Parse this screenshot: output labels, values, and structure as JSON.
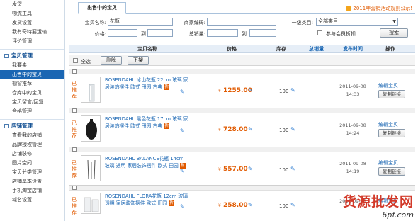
{
  "sidebar": {
    "top_items": [
      {
        "label": "发货"
      },
      {
        "label": "物流工具"
      },
      {
        "label": "发货设置"
      },
      {
        "label": "我有奇特要运输"
      },
      {
        "label": "评价管理"
      }
    ],
    "sections": [
      {
        "title": "宝贝管理",
        "items": [
          {
            "label": "我要卖"
          },
          {
            "label": "出售中的宝贝",
            "active": true
          },
          {
            "label": "橱窗推荐"
          },
          {
            "label": "仓库中的宝贝"
          },
          {
            "label": "宝贝留言/回复"
          },
          {
            "label": "合格管理"
          }
        ]
      },
      {
        "title": "店铺管理",
        "items": [
          {
            "label": "查看我的店铺"
          },
          {
            "label": "品牌授权管理"
          },
          {
            "label": "店铺装修"
          },
          {
            "label": "图片空间"
          },
          {
            "label": "宝贝分类管理"
          },
          {
            "label": "店铺基本设置"
          },
          {
            "label": "手机淘宝店铺"
          },
          {
            "label": "域名设置"
          }
        ]
      }
    ]
  },
  "tabs": {
    "active": "出售中的宝贝"
  },
  "promo": "2011年营销活动规则公示!",
  "search": {
    "name_label": "宝贝名称:",
    "name_value": "花瓶",
    "code_label": "商家编码:",
    "category_label": "一级类目:",
    "category_value": "全部类目",
    "price_label": "价格:",
    "to1": "到",
    "sales_label": "总销量:",
    "to2": "到",
    "member_discount": "参与会员折扣",
    "search_button": "搜索"
  },
  "table": {
    "headers": {
      "name": "宝贝名称",
      "price": "价格",
      "stock": "库存",
      "sales": "总销量",
      "time": "发布时间",
      "action": "操作"
    },
    "select_all": "全选",
    "delete_button": "删除",
    "delist_button": "下架",
    "rows": [
      {
        "tag": "已推荐",
        "name": "ROSENDAHL 冰山花瓶 22cm 玻璃 家居装饰摆件 欧式 田园 古典",
        "price": "1255.00",
        "stock": "100",
        "date": "2011-09-08",
        "time": "14:33",
        "edit": "编辑宝贝",
        "copy": "复制链接"
      },
      {
        "tag": "已推荐",
        "name": "ROSENDAHL 黑色花瓶 17cm 玻璃 家居装饰摆件 欧式 田园 古典",
        "price": "728.00",
        "stock": "100",
        "date": "2011-09-08",
        "time": "14:24",
        "edit": "编辑宝贝",
        "copy": "复制链接"
      },
      {
        "tag": "已推荐",
        "name": "ROSENDAHL BALANCE花瓶 14cm 玻璃 透明 家居装饰摆件 欧式 田园",
        "price": "557.00",
        "stock": "100",
        "date": "2011-09-08",
        "time": "14:19",
        "edit": "编辑宝贝",
        "copy": "复制链接"
      },
      {
        "tag": "已推荐",
        "name": "ROSENDAHL FLORA花瓶 12cm 玻璃 透明 家居装饰摆件 欧式 田园",
        "price": "258.00",
        "stock": "100",
        "date": "2011-09-08",
        "time": "",
        "edit": "编辑宝贝",
        "copy": ""
      }
    ]
  },
  "currency": "¥",
  "watermark": {
    "title": "货源批发网",
    "url": "6pf.com"
  },
  "colors": {
    "accent": "#1a66b3",
    "price": "#e15a00",
    "active_nav": "#1a66b3"
  }
}
